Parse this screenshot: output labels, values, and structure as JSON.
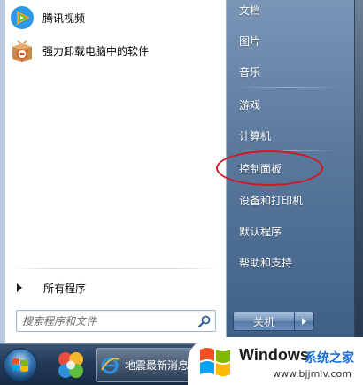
{
  "start_menu": {
    "programs": [
      {
        "label": "腾讯视频",
        "icon": "tencent-video-icon"
      },
      {
        "label": "强力卸载电脑中的软件",
        "icon": "uninstaller-box-icon"
      }
    ],
    "all_programs_label": "所有程序",
    "search": {
      "placeholder": "搜索程序和文件",
      "icon": "search-icon"
    },
    "right_items": [
      {
        "label": "文档"
      },
      {
        "label": "图片"
      },
      {
        "label": "音乐"
      },
      {
        "label": "游戏"
      },
      {
        "label": "计算机"
      },
      {
        "label": "控制面板"
      },
      {
        "label": "设备和打印机"
      },
      {
        "label": "默认程序"
      },
      {
        "label": "帮助和支持"
      }
    ],
    "highlighted_item": "控制面板",
    "shutdown_label": "关机"
  },
  "taskbar": {
    "start_orb_icon": "windows-start-orb-icon",
    "pinned": [
      {
        "icon": "colorful-app-icon"
      }
    ],
    "ie_task": {
      "label": "地震最新消息",
      "icon": "internet-explorer-icon"
    }
  },
  "watermark": {
    "brand": "Windows",
    "cn_text": "系统之家",
    "url": "www.bjjmlv.com"
  },
  "colors": {
    "highlight_ellipse": "#d0181d",
    "right_pane_top": "#7a96b7",
    "right_pane_bottom": "#3f5f86",
    "taskbar": "#233a57",
    "watermark_cn": "#1a6bd6"
  }
}
